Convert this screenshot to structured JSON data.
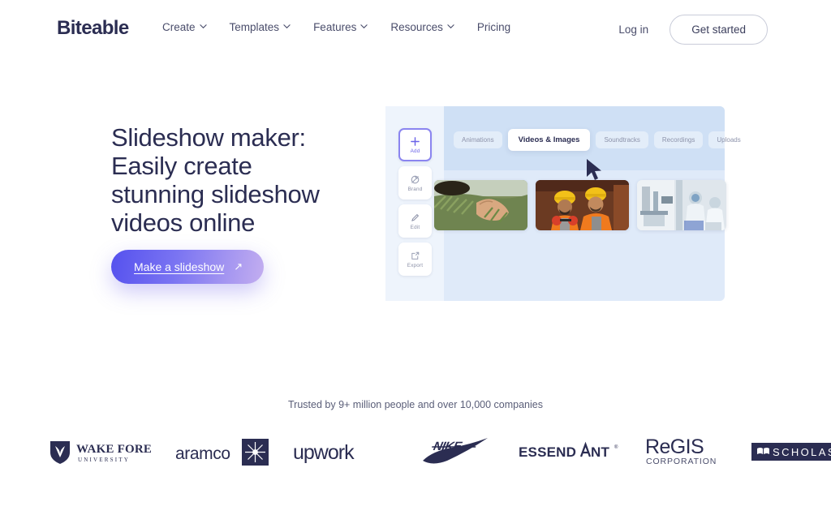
{
  "header": {
    "brand": "Biteable",
    "nav": [
      {
        "label": "Create",
        "has_dropdown": true
      },
      {
        "label": "Templates",
        "has_dropdown": true
      },
      {
        "label": "Features",
        "has_dropdown": true
      },
      {
        "label": "Resources",
        "has_dropdown": true
      },
      {
        "label": "Pricing",
        "has_dropdown": false
      }
    ],
    "login_label": "Log in",
    "get_started_label": "Get started"
  },
  "hero": {
    "title_line1": "Slideshow maker:",
    "title_line2": "Easily create",
    "title_line3": "stunning slideshow",
    "title_line4": "videos online",
    "cta_label": "Make a slideshow",
    "cta_arrow": "↗"
  },
  "mockup": {
    "sidebar": [
      {
        "label": "Add",
        "icon": "plus-icon",
        "active": true
      },
      {
        "label": "Brand",
        "icon": "brand-icon",
        "active": false
      },
      {
        "label": "Edit",
        "icon": "pencil-icon",
        "active": false
      },
      {
        "label": "Export",
        "icon": "export-icon",
        "active": false
      }
    ],
    "tabs": [
      {
        "label": "Animations",
        "active": false
      },
      {
        "label": "Videos & Images",
        "active": true
      },
      {
        "label": "Soundtracks",
        "active": false
      },
      {
        "label": "Recordings",
        "active": false
      },
      {
        "label": "Uploads",
        "active": false
      }
    ],
    "thumbnails": [
      {
        "name": "hands-in-crop-field"
      },
      {
        "name": "construction-workers-hard-hats"
      },
      {
        "name": "laboratory-cleanroom"
      }
    ],
    "cursor": "mouse-pointer-icon"
  },
  "trust": {
    "headline": "Trusted by 9+ million people and over 10,000 companies",
    "logos": [
      {
        "name": "wake-forest-university",
        "text": "WAKE FOREST",
        "subtext": "U N I V E R S I T Y"
      },
      {
        "name": "aramco",
        "text": "aramco"
      },
      {
        "name": "upwork",
        "text": "upwork"
      },
      {
        "name": "nike",
        "text": "NIKE"
      },
      {
        "name": "essendant",
        "text": "ESSENDANT"
      },
      {
        "name": "regis-corporation",
        "text": "ReGIS",
        "subtext": "CORPORATION"
      },
      {
        "name": "scholastic",
        "text": "SCHOLAS"
      }
    ]
  },
  "colors": {
    "brand_navy": "#2b2d52",
    "cta_gradient_start": "#5551ee",
    "cta_gradient_end": "#c3aef0",
    "mockup_bg": "#dfeaf9",
    "accent_purple": "#6a63e8"
  }
}
